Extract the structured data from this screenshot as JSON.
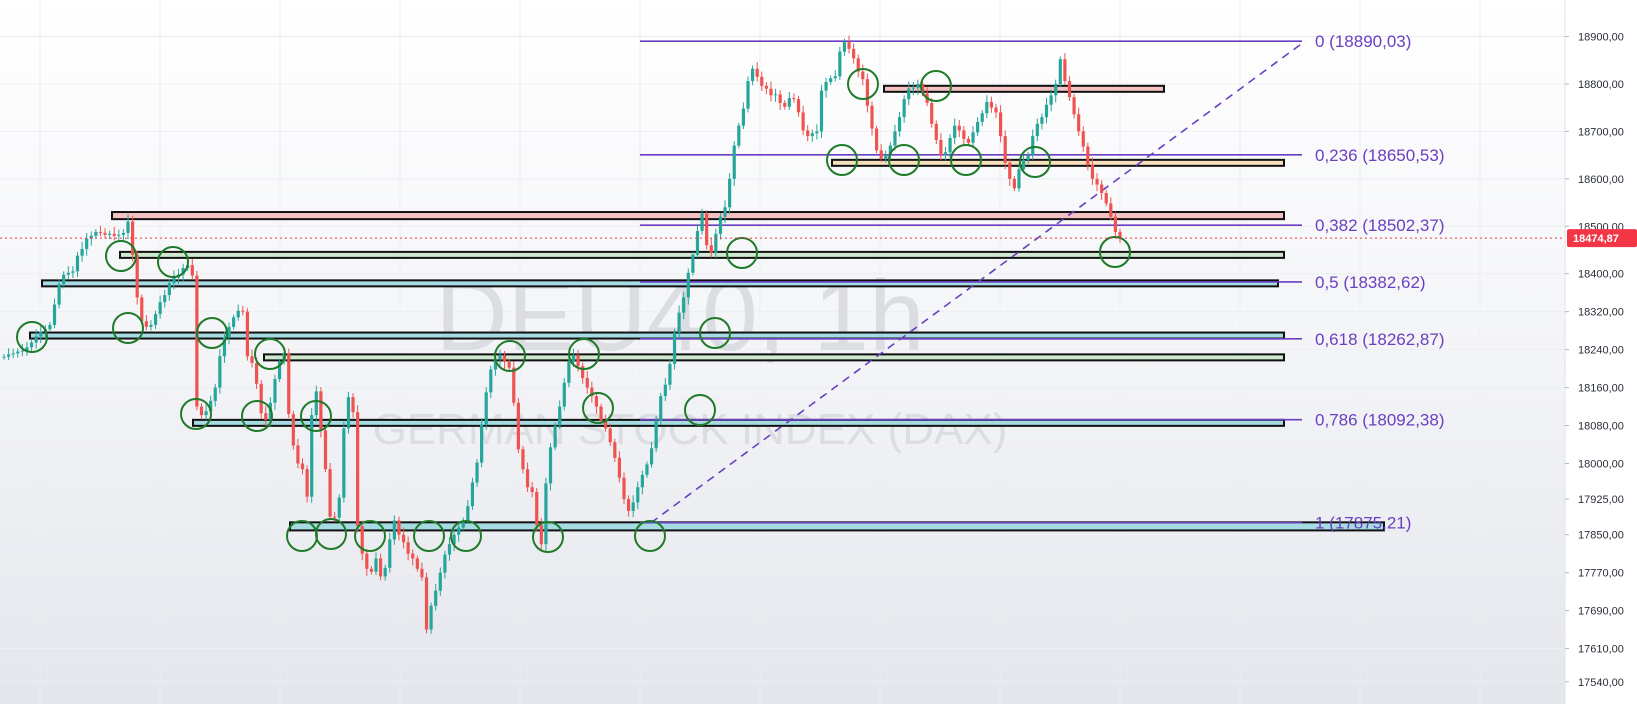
{
  "chart_data": {
    "type": "candlestick",
    "title": "",
    "watermark": {
      "symbol": "DEU40, 1h",
      "name": "GERMAN STOCK INDEX (DAX)"
    },
    "ylim": [
      17510,
      18960
    ],
    "y_ticks": [
      "18900,00",
      "18800,00",
      "18700,00",
      "18600,00",
      "18500,00",
      "18400,00",
      "18320,00",
      "18240,00",
      "18160,00",
      "18080,00",
      "18000,00",
      "17925,00",
      "17850,00",
      "17770,00",
      "17690,00",
      "17610,00",
      "17540,00"
    ],
    "y_tick_values": [
      18900,
      18800,
      18700,
      18600,
      18500,
      18400,
      18320,
      18240,
      18160,
      18080,
      18000,
      17925,
      17850,
      17770,
      17690,
      17610,
      17540
    ],
    "current_price": {
      "value": 18474.87,
      "label": "18474,87"
    },
    "fib_levels": [
      {
        "ratio": "0",
        "value": 18890.03,
        "label": "0 (18890,03)"
      },
      {
        "ratio": "0,236",
        "value": 18650.53,
        "label": "0,236 (18650,53)"
      },
      {
        "ratio": "0,382",
        "value": 18502.37,
        "label": "0,382 (18502,37)"
      },
      {
        "ratio": "0,5",
        "value": 18382.62,
        "label": "0,5 (18382,62)"
      },
      {
        "ratio": "0,618",
        "value": 18262.87,
        "label": "0,618 (18262,87)"
      },
      {
        "ratio": "0,786",
        "value": 18092.38,
        "label": "0,786 (18092,38)"
      },
      {
        "ratio": "1",
        "value": 17875.21,
        "label": "1 (17875,21)"
      }
    ],
    "zones": [
      {
        "kind": "resistance",
        "low": 18786,
        "high": 18796,
        "color": "#f4c2c2"
      },
      {
        "kind": "support",
        "low": 18632,
        "high": 18640,
        "color": "#f6dfbd"
      },
      {
        "kind": "resistance",
        "low": 18515,
        "high": 18530,
        "color": "#f4c2c2"
      },
      {
        "kind": "support",
        "low": 18440,
        "high": 18446,
        "color": "#cfe8cf"
      },
      {
        "kind": "support",
        "low": 18376,
        "high": 18386,
        "color": "#a7dbe3"
      },
      {
        "kind": "support",
        "low": 18267,
        "high": 18276,
        "color": "#a7dbe3"
      },
      {
        "kind": "support",
        "low": 18224,
        "high": 18230,
        "color": "#cfe8cf"
      },
      {
        "kind": "support",
        "low": 18082,
        "high": 18092,
        "color": "#a7dbe3"
      },
      {
        "kind": "support",
        "low": 17859,
        "high": 17876,
        "color": "#a7dbe3"
      }
    ],
    "candle_closes": [
      18225,
      18230,
      18232,
      18236,
      18238,
      18245,
      18255,
      18268,
      18278,
      18283,
      18292,
      18335,
      18378,
      18398,
      18402,
      18405,
      18438,
      18452,
      18474,
      18480,
      18488,
      18486,
      18482,
      18484,
      18480,
      18482,
      18486,
      18510,
      18440,
      18350,
      18300,
      18288,
      18292,
      18315,
      18340,
      18355,
      18380,
      18392,
      18398,
      18412,
      18418,
      18396,
      18120,
      18102,
      18110,
      18132,
      18160,
      18226,
      18266,
      18288,
      18308,
      18322,
      18320,
      18226,
      18212,
      18168,
      18106,
      18092,
      18128,
      18178,
      18215,
      18232,
      18104,
      18038,
      18000,
      17988,
      17930,
      18102,
      18152,
      18070,
      17988,
      17888,
      17886,
      17928,
      18074,
      18140,
      18108,
      17868,
      17810,
      17778,
      17772,
      17800,
      17762,
      17780,
      17840,
      17880,
      17850,
      17834,
      17810,
      17800,
      17778,
      17760,
      17650,
      17700,
      17732,
      17770,
      17808,
      17830,
      17850,
      17865,
      17880,
      17910,
      17960,
      18002,
      18082,
      18150,
      18198,
      18220,
      18228,
      18214,
      18202,
      18128,
      18030,
      17988,
      17950,
      17940,
      17870,
      17830,
      17958,
      18034,
      18080,
      18120,
      18170,
      18214,
      18228,
      18205,
      18180,
      18160,
      18142,
      18120,
      18090,
      18074,
      18045,
      18012,
      17970,
      17925,
      17900,
      17918,
      17950,
      17976,
      17998,
      18032,
      18090,
      18142,
      18166,
      18210,
      18276,
      18318,
      18350,
      18402,
      18440,
      18490,
      18527,
      18460,
      18444,
      18484,
      18520,
      18540,
      18600,
      18670,
      18712,
      18748,
      18806,
      18832,
      18815,
      18796,
      18790,
      18776,
      18778,
      18760,
      18752,
      18770,
      18768,
      18740,
      18702,
      18690,
      18696,
      18700,
      18786,
      18804,
      18812,
      18816,
      18868,
      18888,
      18874,
      18854,
      18826,
      18810,
      18754,
      18706,
      18660,
      18642,
      18650,
      18670,
      18700,
      18730,
      18768,
      18790,
      18792,
      18800,
      18780,
      18760,
      18716,
      18682,
      18650,
      18656,
      18686,
      18712,
      18702,
      18684,
      18676,
      18698,
      18720,
      18738,
      18762,
      18750,
      18740,
      18690,
      18634,
      18600,
      18580,
      18620,
      18640,
      18650,
      18690,
      18716,
      18730,
      18756,
      18776,
      18800,
      18852,
      18806,
      18772,
      18736,
      18700,
      18668,
      18630,
      18600,
      18588,
      18570,
      18548,
      18520,
      18488,
      18474
    ],
    "trendline": {
      "from_value": 17875.21,
      "to_value": 18890.03,
      "style": "dashed",
      "color": "#6a3fc2"
    },
    "colors": {
      "bull": "#26a69a",
      "bear": "#ef5350",
      "fib": "#6a3fc2",
      "circle": "#1f7a2a",
      "badge": "#f23645"
    }
  }
}
